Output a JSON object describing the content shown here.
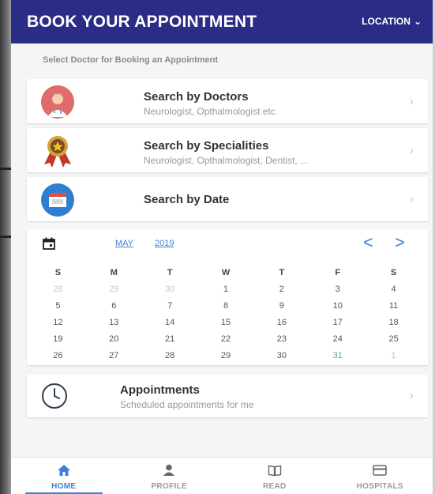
{
  "appbar": {
    "title": "BOOK YOUR APPOINTMENT",
    "location_label": "LOCATION",
    "location_icon": "chevron-down-icon"
  },
  "section_label": "Select Doctor for Booking an Appointment",
  "menu": [
    {
      "title": "Search by Doctors",
      "subtitle": "Neurologist, Opthalmologist etc",
      "icon": "doctor-icon"
    },
    {
      "title": "Search by Specialities",
      "subtitle": "Neurologist, Opthalmologist, Dentist, ...",
      "icon": "award-ribbon-icon"
    },
    {
      "title": "Search by Date",
      "subtitle": "",
      "icon": "calendar-icon"
    }
  ],
  "calendar": {
    "month": "MAY",
    "year": "2019",
    "prev": "<",
    "next": ">",
    "weekdays": [
      "S",
      "M",
      "T",
      "W",
      "T",
      "F",
      "S"
    ],
    "weeks": [
      [
        "28",
        "29",
        "30",
        "1",
        "2",
        "3",
        "4"
      ],
      [
        "5",
        "6",
        "7",
        "8",
        "9",
        "10",
        "11"
      ],
      [
        "12",
        "13",
        "14",
        "15",
        "16",
        "17",
        "18"
      ],
      [
        "19",
        "20",
        "21",
        "22",
        "23",
        "24",
        "25"
      ],
      [
        "26",
        "27",
        "28",
        "29",
        "30",
        "31",
        "1"
      ]
    ],
    "highlight_day": "31"
  },
  "appointments": {
    "title": "Appointments",
    "subtitle": "Scheduled appointments for me",
    "icon": "clock-icon"
  },
  "bottom_nav": [
    {
      "label": "HOME",
      "icon": "home-icon",
      "active": true
    },
    {
      "label": "PROFILE",
      "icon": "profile-icon",
      "active": false
    },
    {
      "label": "READ",
      "icon": "book-icon",
      "active": false
    },
    {
      "label": "HOSPITALS",
      "icon": "hospital-card-icon",
      "active": false
    }
  ],
  "colors": {
    "appbar": "#2b2c86",
    "accent": "#3f7fd6",
    "today": "#3fbf6e"
  }
}
